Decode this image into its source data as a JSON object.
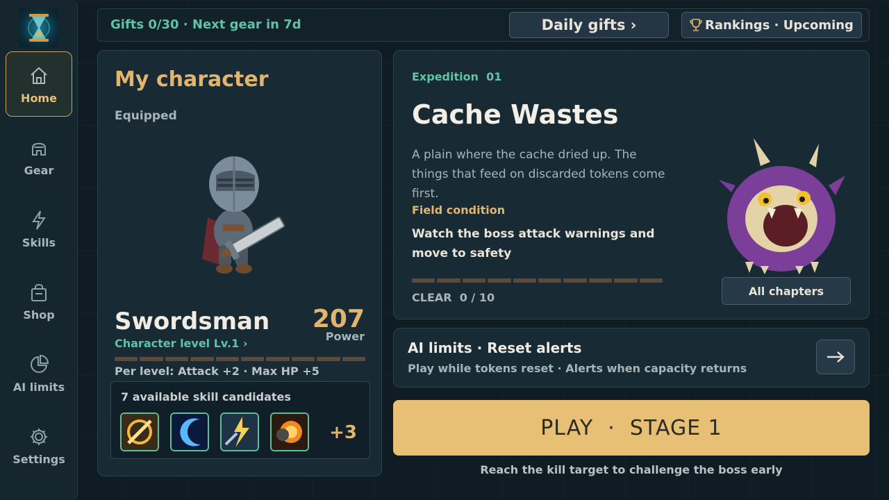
{
  "nav": {
    "items": [
      {
        "label": "Home",
        "icon": "home-icon",
        "active": true
      },
      {
        "label": "Gear",
        "icon": "helmet-icon"
      },
      {
        "label": "Skills",
        "icon": "lightning-icon"
      },
      {
        "label": "Shop",
        "icon": "bag-icon"
      },
      {
        "label": "AI limits",
        "icon": "pie-icon"
      },
      {
        "label": "Settings",
        "icon": "gear-icon"
      }
    ]
  },
  "topbar": {
    "gifts": "Gifts 0/30 · Next gear in 7d",
    "daily_gifts": "Daily gifts ›",
    "rankings": "Rankings · Upcoming"
  },
  "character": {
    "title": "My character",
    "equipped": "Equipped",
    "name": "Swordsman",
    "level": "Character level Lv.1 ›",
    "power_value": "207",
    "power_label": "Power",
    "level_progress": 0,
    "per_level": "Per level: Attack +2 · Max HP +5",
    "skills_title": "7 available skill candidates",
    "skills": [
      {
        "icon": "slash-skill-icon"
      },
      {
        "icon": "crescent-skill-icon"
      },
      {
        "icon": "lightning-strike-skill-icon"
      },
      {
        "icon": "fire-spin-skill-icon"
      }
    ],
    "skills_more": "+3"
  },
  "expedition": {
    "label": "Expedition  01",
    "title": "Cache Wastes",
    "description": "A plain where the cache dried up. The things that feed on discarded tokens come first.",
    "field_label": "Field condition",
    "field_text": "Watch the boss attack warnings and move to safety",
    "clear_label": "CLEAR  0 / 10",
    "clear_progress": 0,
    "chapters_button": "All chapters"
  },
  "limits": {
    "title": "AI limits · Reset alerts",
    "subtitle": "Play while tokens reset · Alerts when capacity returns"
  },
  "play": {
    "label": "PLAY  ·  STAGE 1",
    "hint": "Reach the kill target to challenge the boss early"
  },
  "colors": {
    "accent_gold": "#e7bf75",
    "accent_teal": "#5fc3a8",
    "panel": "#182a33"
  }
}
